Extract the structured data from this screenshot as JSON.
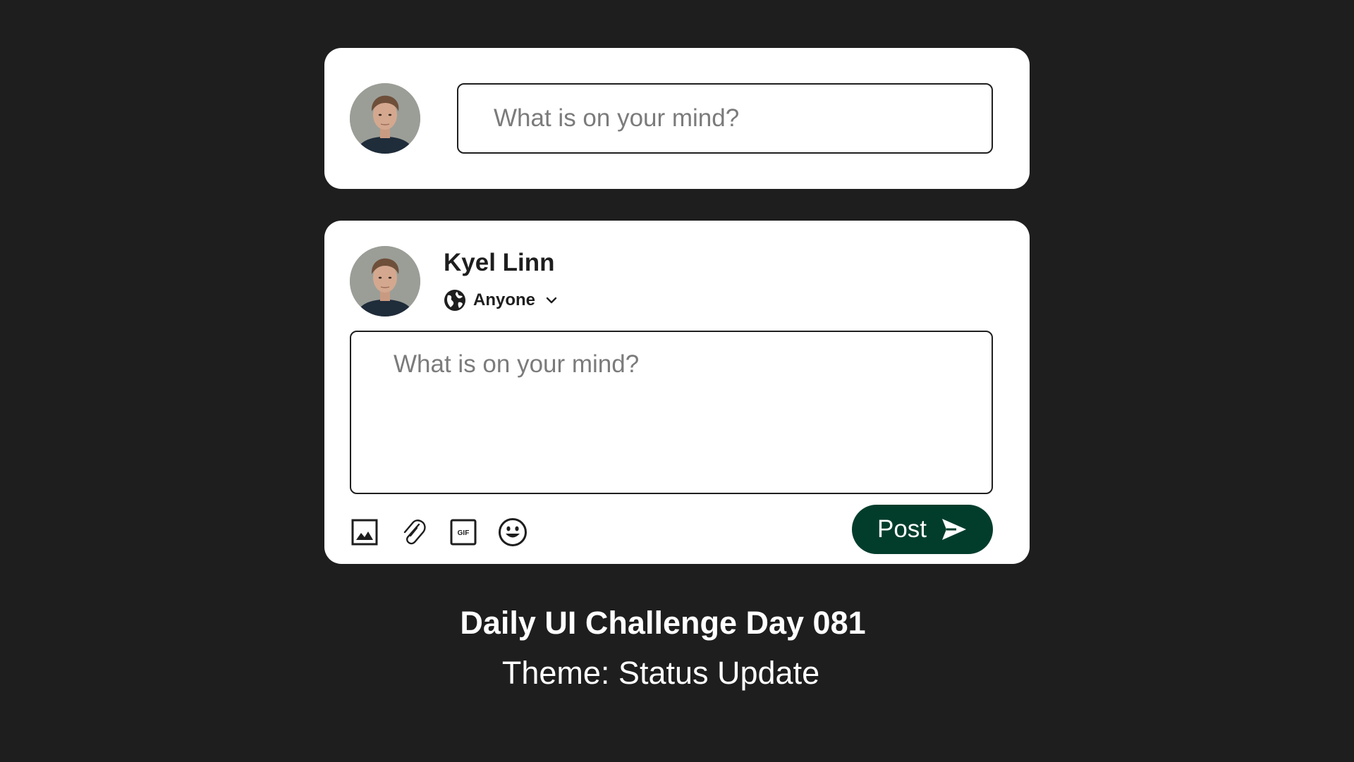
{
  "composer_compact": {
    "placeholder": "What is on your mind?"
  },
  "composer_expanded": {
    "user_name": "Kyel Linn",
    "audience": "Anyone",
    "placeholder": "What is on your mind?",
    "toolbar": {
      "icons": [
        "image-icon",
        "paperclip-icon",
        "gif-icon",
        "emoji-icon"
      ],
      "gif_text": "GIF"
    },
    "post_label": "Post"
  },
  "caption": {
    "title": "Daily UI Challenge Day 081",
    "subtitle": "Theme: Status Update"
  },
  "colors": {
    "background": "#1e1e1e",
    "card": "#ffffff",
    "accent": "#023d2c",
    "placeholder": "#7b7b7b"
  }
}
